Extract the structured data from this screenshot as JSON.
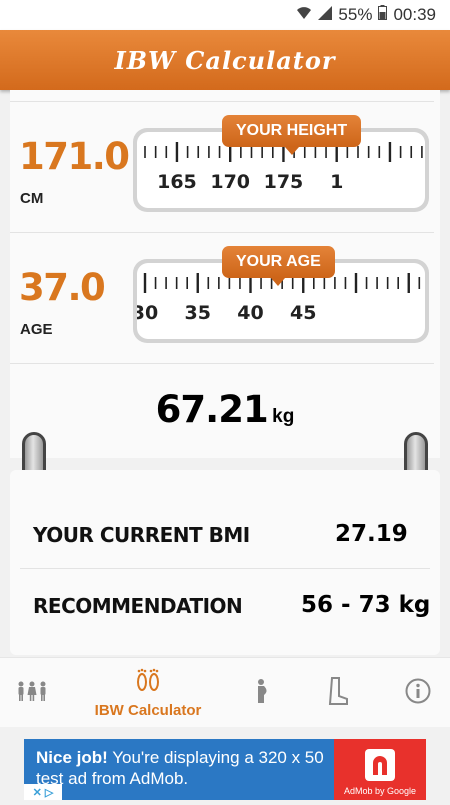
{
  "status_bar": {
    "battery": "55%",
    "time": "00:39"
  },
  "app_bar": {
    "title": "IBW Calculator"
  },
  "height": {
    "value": "171.0",
    "unit": "CM",
    "ruler_label": "YOUR HEIGHT",
    "ticks": [
      "165",
      "170",
      "175",
      "1"
    ]
  },
  "age": {
    "value": "37.0",
    "unit": "AGE",
    "ruler_label": "YOUR AGE",
    "ticks": [
      "30",
      "35",
      "40",
      "45"
    ]
  },
  "result": {
    "value": "67.21",
    "unit": "kg"
  },
  "bmi": {
    "label": "YOUR CURRENT BMI",
    "value": "27.19"
  },
  "recommendation": {
    "label": "RECOMMENDATION",
    "value": "56 - 73 kg"
  },
  "nav": {
    "items": [
      {
        "icon": "family-icon"
      },
      {
        "icon": "footprints-icon",
        "label": "IBW Calculator"
      },
      {
        "icon": "pregnancy-icon"
      },
      {
        "icon": "boot-icon"
      },
      {
        "icon": "info-icon"
      }
    ]
  },
  "ad": {
    "headline": "Nice job!",
    "body": "You're displaying a 320 x 50 test ad from AdMob.",
    "brand": "AdMob by Google"
  },
  "colors": {
    "accent": "#d9771f",
    "app_bar": "#e07a2a",
    "ad_bg": "#2b78c4",
    "ad_logo": "#e8312c"
  }
}
